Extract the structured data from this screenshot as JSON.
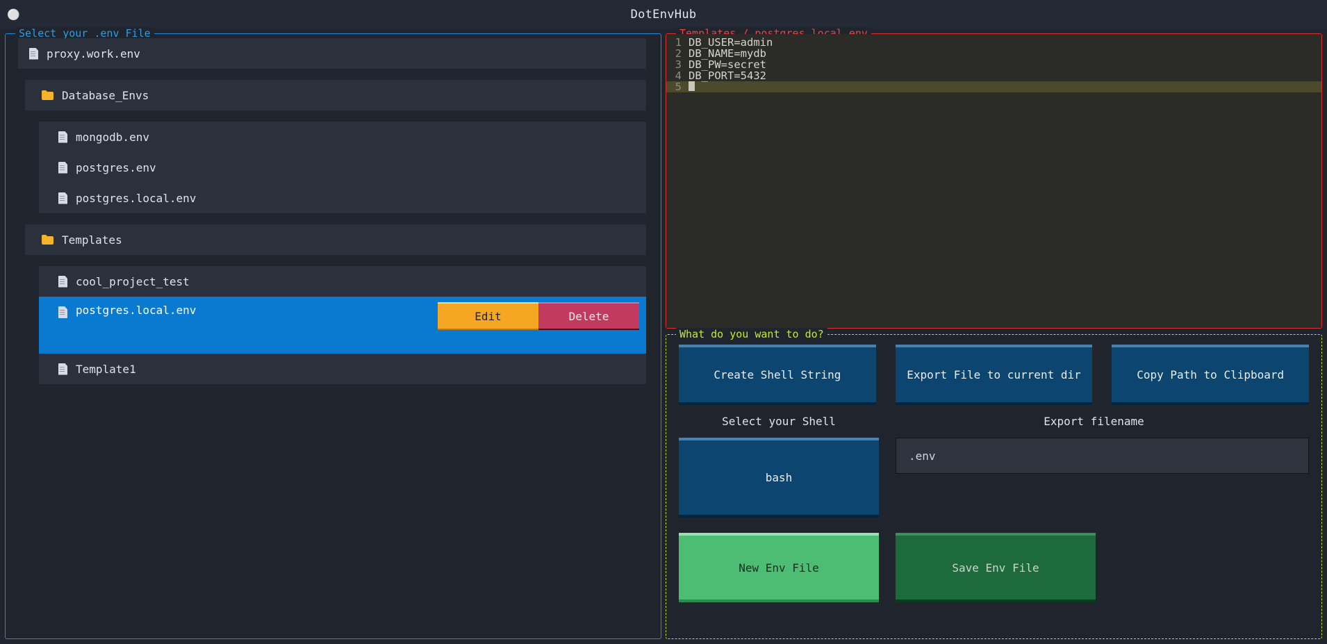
{
  "window": {
    "title": "DotEnvHub",
    "icon": "circle-icon"
  },
  "file_panel": {
    "legend": "Select your .env File",
    "border_color": "#1c8adb",
    "items": [
      {
        "type": "file",
        "icon": "file-icon",
        "label": "proxy.work.env",
        "indent": 0,
        "selected": false,
        "spacer_after": true
      },
      {
        "type": "folder",
        "icon": "folder-icon",
        "label": "Database_Envs",
        "indent": 1,
        "selected": false,
        "spacer_after": true
      },
      {
        "type": "file",
        "icon": "file-icon",
        "label": "mongodb.env",
        "indent": 2,
        "selected": false,
        "spacer_after": false
      },
      {
        "type": "file",
        "icon": "file-icon",
        "label": "postgres.env",
        "indent": 2,
        "selected": false,
        "spacer_after": false
      },
      {
        "type": "file",
        "icon": "file-icon",
        "label": "postgres.local.env",
        "indent": 2,
        "selected": false,
        "spacer_after": true
      },
      {
        "type": "folder",
        "icon": "folder-icon",
        "label": "Templates",
        "indent": 1,
        "selected": false,
        "spacer_after": true
      },
      {
        "type": "file",
        "icon": "file-icon",
        "label": "cool_project_test",
        "indent": 2,
        "selected": false,
        "spacer_after": false
      },
      {
        "type": "file",
        "icon": "file-icon",
        "label": "postgres.local.env",
        "indent": 2,
        "selected": true,
        "spacer_after": false
      },
      {
        "type": "file",
        "icon": "file-icon",
        "label": "Template1",
        "indent": 2,
        "selected": false,
        "spacer_after": false
      }
    ],
    "row_actions": {
      "edit_label": "Edit",
      "edit_color": "#f5a623",
      "delete_label": "Delete",
      "delete_color": "#c23b5e"
    },
    "selection_color": "#0a7ad1"
  },
  "editor_panel": {
    "legend": "Templates / postgres.local.env",
    "border_color": "#e02f2f",
    "lines": [
      {
        "n": "1",
        "text": "DB_USER=admin",
        "active": false
      },
      {
        "n": "2",
        "text": "DB_NAME=mydb",
        "active": false
      },
      {
        "n": "3",
        "text": "DB_PW=secret",
        "active": false
      },
      {
        "n": "4",
        "text": "DB_PORT=5432",
        "active": false
      },
      {
        "n": "5",
        "text": "",
        "active": true
      }
    ]
  },
  "actions_panel": {
    "legend": "What do you want to do?",
    "border_color": "#b8e02f",
    "top_buttons": [
      {
        "label": "Create Shell String"
      },
      {
        "label": "Export File to current dir"
      },
      {
        "label": "Copy Path to Clipboard"
      }
    ],
    "shell_label": "Select your Shell",
    "shell_value": "bash",
    "filename_label": "Export filename",
    "filename_value": ".env",
    "filename_placeholder": ".env",
    "new_button": "New Env File",
    "save_button": "Save Env File"
  }
}
